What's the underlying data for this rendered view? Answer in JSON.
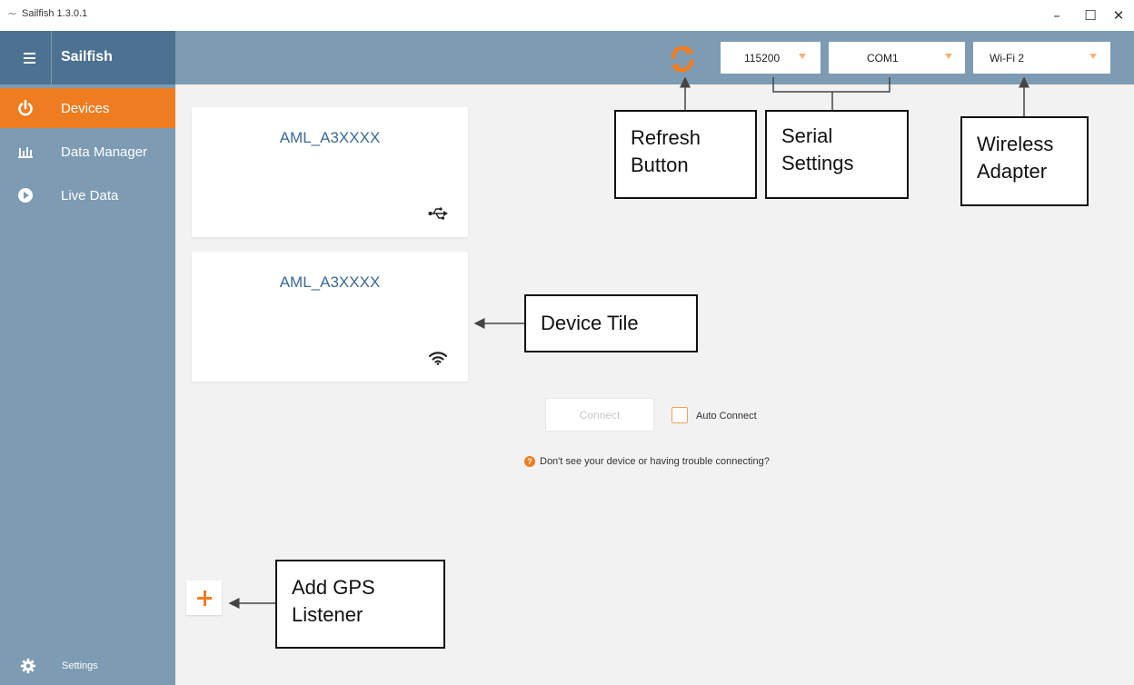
{
  "window": {
    "title": "Sailfish 1.3.0.1",
    "logo_icon": "wave-logo-icon",
    "controls": {
      "minimize": "–",
      "maximize": "☐",
      "close": "✕"
    }
  },
  "sidebar": {
    "brand": "Sailfish",
    "items": [
      {
        "label": "Devices",
        "icon": "power-icon",
        "active": true
      },
      {
        "label": "Data Manager",
        "icon": "bar-chart-icon",
        "active": false
      },
      {
        "label": "Live Data",
        "icon": "play-icon",
        "active": false
      }
    ],
    "settings": {
      "label": "Settings",
      "icon": "gear-icon"
    }
  },
  "toolbar": {
    "baud_rate": "115200",
    "com_port": "COM1",
    "wireless_adapter": "Wi-Fi 2",
    "refresh_icon": "refresh-icon"
  },
  "devices": [
    {
      "name": "AML_A3XXXX",
      "connection_icon": "usb-icon"
    },
    {
      "name": "AML_A3XXXX",
      "connection_icon": "wifi-icon"
    }
  ],
  "connect": {
    "button_label": "Connect",
    "auto_connect_label": "Auto Connect",
    "auto_connect_checked": false,
    "help_text": "Don't see your device or having trouble connecting?",
    "help_icon": "?"
  },
  "add_gps": {
    "icon": "plus-icon"
  },
  "annotations": {
    "refresh": [
      "Refresh",
      "Button"
    ],
    "serial": [
      "Serial",
      "Settings"
    ],
    "wireless": [
      "Wireless",
      "Adapter"
    ],
    "device_tile": [
      "Device Tile"
    ],
    "add_gps": [
      "Add GPS",
      "Listener"
    ]
  },
  "colors": {
    "accent": "#ee7d22",
    "sidebar": "#7d9bb3",
    "sidebar_header": "#4d7191",
    "device_name": "#3c6a95",
    "content_bg": "#f2f2f2"
  }
}
